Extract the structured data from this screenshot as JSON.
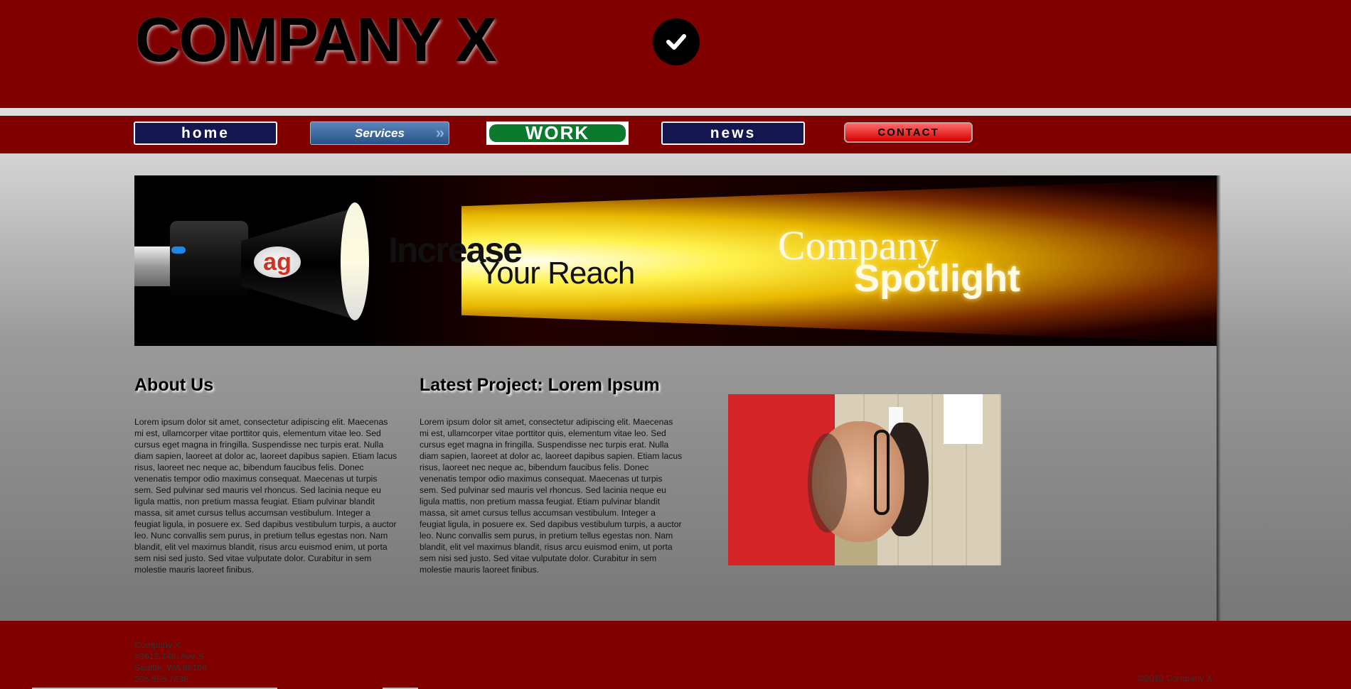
{
  "header": {
    "logo": "COMPANY X",
    "check_icon": "check-circle-icon"
  },
  "nav": {
    "home": "home",
    "services": "Services",
    "work": "WORK",
    "news": "news",
    "contact": "CONTACT"
  },
  "banner": {
    "line1": "Increase",
    "line2": "Your Reach",
    "spot1": "Company",
    "spot2": "Spotlight",
    "badge": "ag"
  },
  "about": {
    "title": "About Us",
    "body": "Lorem ipsum dolor sit amet, consectetur adipiscing elit. Maecenas mi est, ullamcorper vitae porttitor quis, elementum vitae leo. Sed cursus eget magna in fringilla. Suspendisse nec turpis erat. Nulla diam sapien, laoreet at dolor ac, laoreet dapibus sapien. Etiam lacus risus, laoreet nec neque ac, bibendum faucibus felis. Donec venenatis tempor odio maximus consequat. Maecenas ut turpis sem. Sed pulvinar sed mauris vel rhoncus. Sed lacinia neque eu ligula mattis, non pretium massa feugiat. Etiam pulvinar blandit massa, sit amet cursus tellus accumsan vestibulum. Integer a feugiat ligula, in posuere ex. Sed dapibus vestibulum turpis, a auctor leo. Nunc convallis sem purus, in pretium tellus egestas non. Nam blandit, elit vel maximus blandit, risus arcu euismod enim, ut porta sem nisi sed justo. Sed vitae vulputate dolor. Curabitur in sem molestie mauris laoreet finibus."
  },
  "project": {
    "title": "Latest Project: Lorem Ipsum",
    "body": "Lorem ipsum dolor sit amet, consectetur adipiscing elit. Maecenas mi est, ullamcorper vitae porttitor quis, elementum vitae leo. Sed cursus eget magna in fringilla. Suspendisse nec turpis erat. Nulla diam sapien, laoreet at dolor ac, laoreet dapibus sapien. Etiam lacus risus, laoreet nec neque ac, bibendum faucibus felis. Donec venenatis tempor odio maximus consequat. Maecenas ut turpis sem. Sed pulvinar sed mauris vel rhoncus. Sed lacinia neque eu ligula mattis, non pretium massa feugiat. Etiam pulvinar blandit massa, sit amet cursus tellus accumsan vestibulum. Integer a feugiat ligula, in posuere ex. Sed dapibus vestibulum turpis, a auctor leo. Nunc convallis sem purus, in pretium tellus egestas non. Nam blandit, elit vel maximus blandit, risus arcu euismod enim, ut porta sem nisi sed justo. Sed vitae vulputate dolor. Curabitur in sem molestie mauris laoreet finibus."
  },
  "footer": {
    "address": [
      "Company X",
      "#3612 14th Ave S",
      "Seattle, WA 95108",
      "205.555.7636"
    ],
    "copyright": "©2010 Company X"
  },
  "colors": {
    "brand_red": "#800000",
    "nav_navy": "#14164f",
    "work_green": "#0c7a2e"
  }
}
